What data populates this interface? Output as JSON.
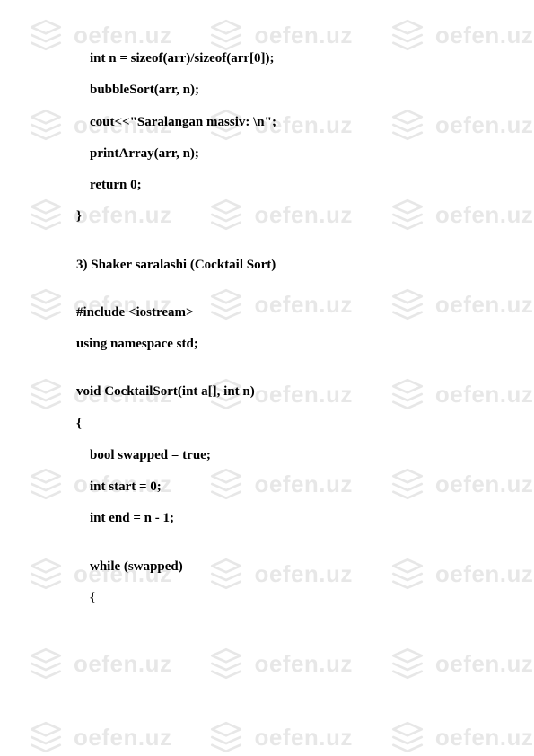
{
  "watermark": {
    "text": "oefen.uz"
  },
  "code": {
    "lines": [
      "    int n = sizeof(arr)/sizeof(arr[0]);",
      "    bubbleSort(arr, n);",
      "    cout<<\"Saralangan massiv: \\n\";",
      "    printArray(arr, n);",
      "    return 0;",
      "}",
      "",
      "3) Shaker saralashi (Cocktail Sort)",
      "",
      "#include <iostream>",
      "using namespace std;",
      "",
      "void CocktailSort(int a[], int n)",
      "{",
      "    bool swapped = true;",
      "    int start = 0;",
      "    int end = n - 1;",
      "",
      "    while (swapped)",
      "    {"
    ]
  }
}
